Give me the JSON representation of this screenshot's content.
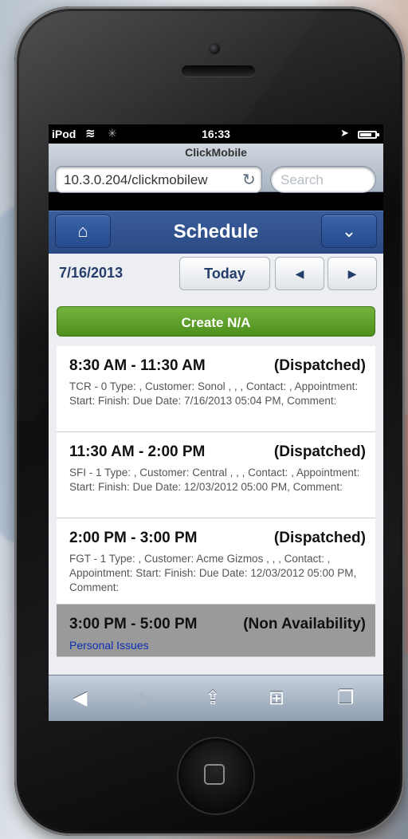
{
  "status_bar": {
    "carrier": "iPod",
    "time": "16:33",
    "battery_level": 0.75
  },
  "browser": {
    "page_title": "ClickMobile",
    "url": "10.3.0.204/clickmobilew",
    "search_placeholder": "Search"
  },
  "header": {
    "title": "Schedule"
  },
  "date_nav": {
    "date": "7/16/2013",
    "today_label": "Today",
    "prev_label": "◀",
    "next_label": "▶"
  },
  "create_button": "Create N/A",
  "appointments": [
    {
      "time": "8:30 AM - 11:30 AM",
      "status": "(Dispatched)",
      "detail": "TCR - 0 Type: , Customer: Sonol , , ,  Contact: , Appointment: Start:  Finish:  Due Date: 7/16/2013 05:04 PM, Comment:"
    },
    {
      "time": "11:30 AM - 2:00 PM",
      "status": "(Dispatched)",
      "detail": "SFI - 1 Type: , Customer: Central , , ,  Contact: , Appointment: Start:  Finish:  Due Date: 12/03/2012 05:00 PM, Comment:"
    },
    {
      "time": "2:00 PM - 3:00 PM",
      "status": "(Dispatched)",
      "detail": "FGT - 1 Type: , Customer: Acme Gizmos , , , Contact: ,  Appointment: Start:  Finish:  Due Date: 12/03/2012 05:00 PM, Comment:"
    },
    {
      "time": "3:00 PM - 5:00 PM",
      "status": "(Non Availability)",
      "detail": "Personal Issues"
    }
  ]
}
